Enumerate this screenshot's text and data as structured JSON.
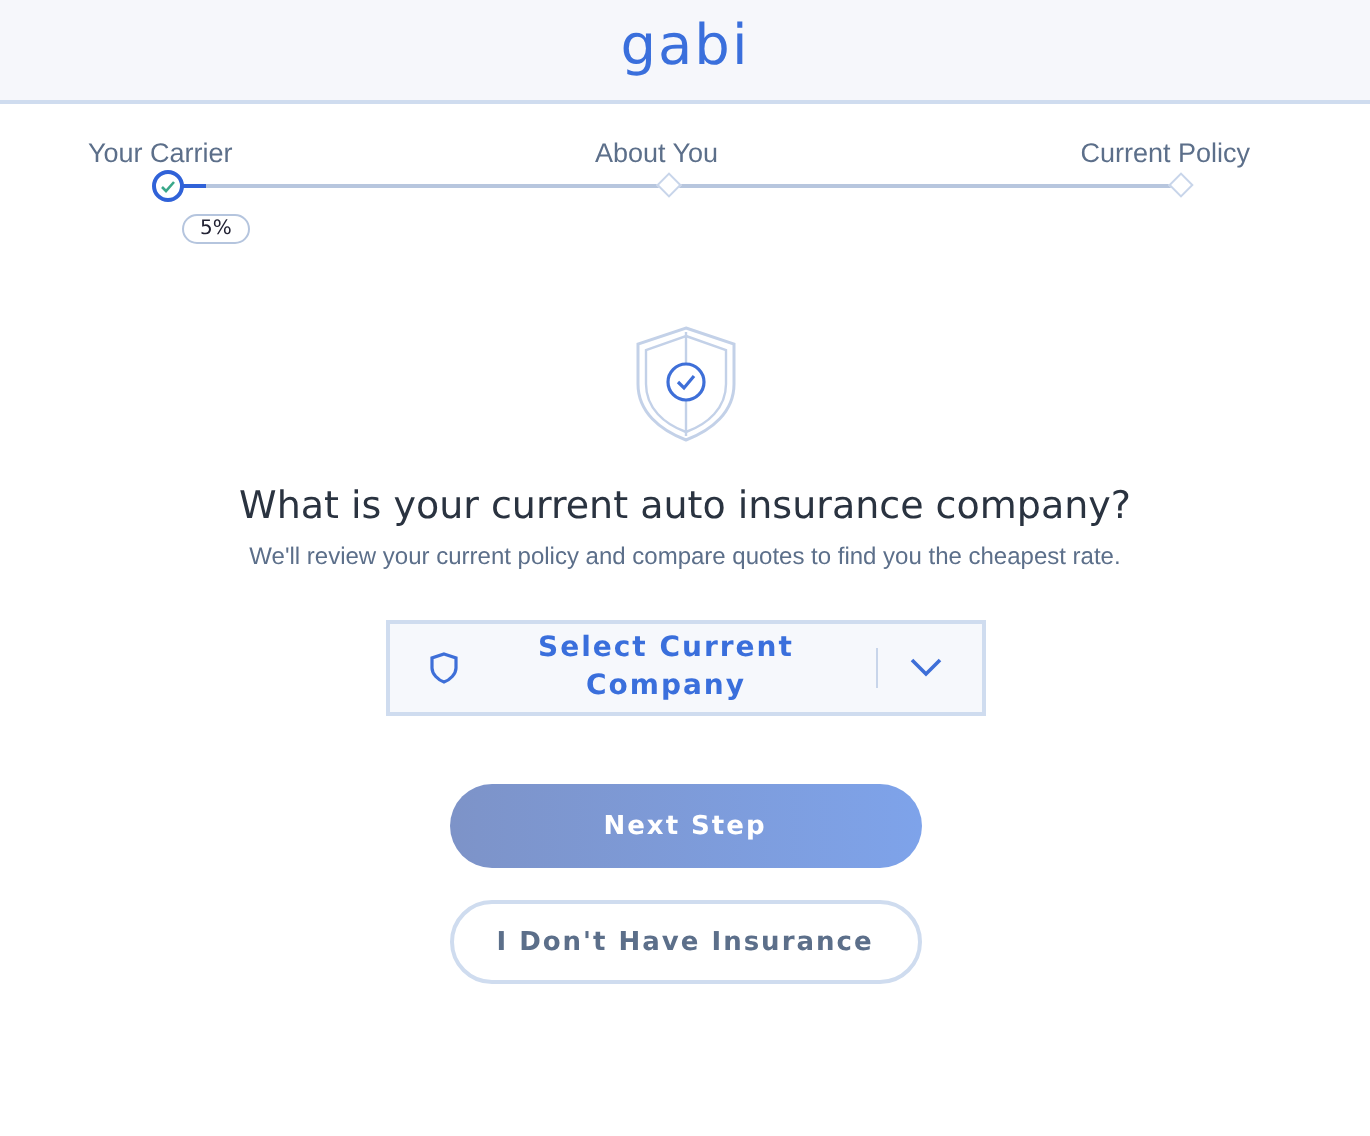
{
  "header": {
    "logo": "gabi"
  },
  "progress": {
    "steps": [
      {
        "label": "Your Carrier",
        "completed": true
      },
      {
        "label": "About You",
        "completed": false
      },
      {
        "label": "Current Policy",
        "completed": false
      }
    ],
    "level": 0.05,
    "reading": "5%"
  },
  "question": {
    "title": "What is your current auto insurance company?",
    "subtitle": "We'll review your current policy and compare quotes to find you the cheapest rate."
  },
  "select": {
    "placeholder": "Select Current Company"
  },
  "buttons": [
    {
      "label": "Next Step",
      "kind": "primary"
    },
    {
      "label": "I Don't Have Insurance",
      "kind": "secondary"
    }
  ]
}
